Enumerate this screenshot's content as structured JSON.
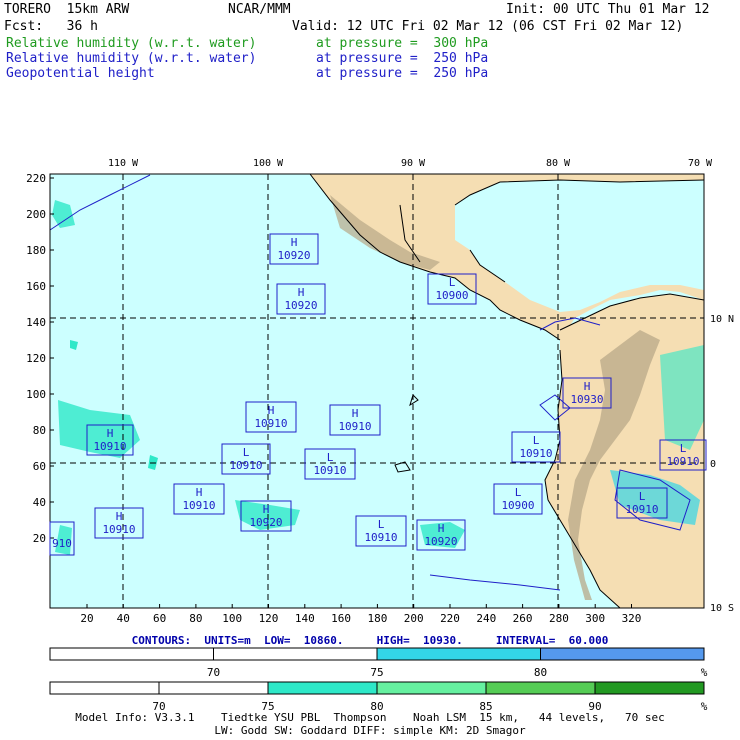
{
  "header": {
    "model": "TORERO  15km ARW",
    "center": "NCAR/MMM",
    "init": "Init: 00 UTC Thu 01 Mar 12",
    "fcst": "Fcst:   36 h",
    "valid": "Valid: 12 UTC Fri 02 Mar 12 (06 CST Fri 02 Mar 12)",
    "fields": [
      {
        "name": "Relative humidity (w.r.t. water)",
        "level": "at pressure =  300 hPa",
        "color": "#1f9b1f"
      },
      {
        "name": "Relative humidity (w.r.t. water)",
        "level": "at pressure =  250 hPa",
        "color": "#2020c8"
      },
      {
        "name": "Geopotential height",
        "level": "at pressure =  250 hPa",
        "color": "#2020c8"
      }
    ]
  },
  "map": {
    "top_lon_labels": [
      "110 W",
      "100 W",
      "90 W",
      "80 W",
      "70 W"
    ],
    "right_lat_labels": [
      "10 N",
      "0",
      "10 S"
    ],
    "y_ticks": [
      "220",
      "200",
      "180",
      "160",
      "140",
      "120",
      "100",
      "80",
      "60",
      "40",
      "20"
    ],
    "x_ticks": [
      "20",
      "40",
      "60",
      "80",
      "100",
      "120",
      "140",
      "160",
      "180",
      "200",
      "220",
      "240",
      "260",
      "280",
      "300",
      "320"
    ],
    "highs_lows": [
      {
        "type": "H",
        "value": "10920"
      },
      {
        "type": "H",
        "value": "10920"
      },
      {
        "type": "L",
        "value": "10900"
      },
      {
        "type": "H",
        "value": "10930"
      },
      {
        "type": "H",
        "value": "10910"
      },
      {
        "type": "H",
        "value": "10910"
      },
      {
        "type": "H",
        "value": "10910"
      },
      {
        "type": "L",
        "value": "10910"
      },
      {
        "type": "L",
        "value": "10910"
      },
      {
        "type": "H",
        "value": "10910"
      },
      {
        "type": "L",
        "value": "10910"
      },
      {
        "type": "L",
        "value": "10910"
      },
      {
        "type": "L",
        "value": "10900"
      },
      {
        "type": "H",
        "value": "10920"
      },
      {
        "type": "H",
        "value": "10910"
      },
      {
        "type": "L",
        "value": "10910"
      },
      {
        "type": "H",
        "value": "10920"
      },
      {
        "type": "L",
        "value": "10910"
      },
      {
        "type": "",
        "value": "910"
      }
    ]
  },
  "contours": "CONTOURS:  UNITS=m  LOW=  10860.     HIGH=  10930.     INTERVAL=  60.000",
  "colorbar_250": {
    "labels": [
      "70",
      "75",
      "80",
      "%"
    ],
    "colors": [
      "#ffffff",
      "#ffffff",
      "#33d6e8",
      "#5599ee"
    ]
  },
  "colorbar_300": {
    "labels": [
      "70",
      "75",
      "80",
      "85",
      "90",
      "%"
    ],
    "colors": [
      "#ffffff",
      "#ffffff",
      "#2ee8c8",
      "#66f0a0",
      "#55cc55",
      "#229922"
    ]
  },
  "footer": {
    "line1": "Model Info: V3.3.1    Tiedtke YSU PBL  Thompson    Noah LSM  15 km,   44 levels,   70 sec",
    "line2": "LW: Godd SW: Goddard DIFF: simple KM: 2D Smagor"
  }
}
